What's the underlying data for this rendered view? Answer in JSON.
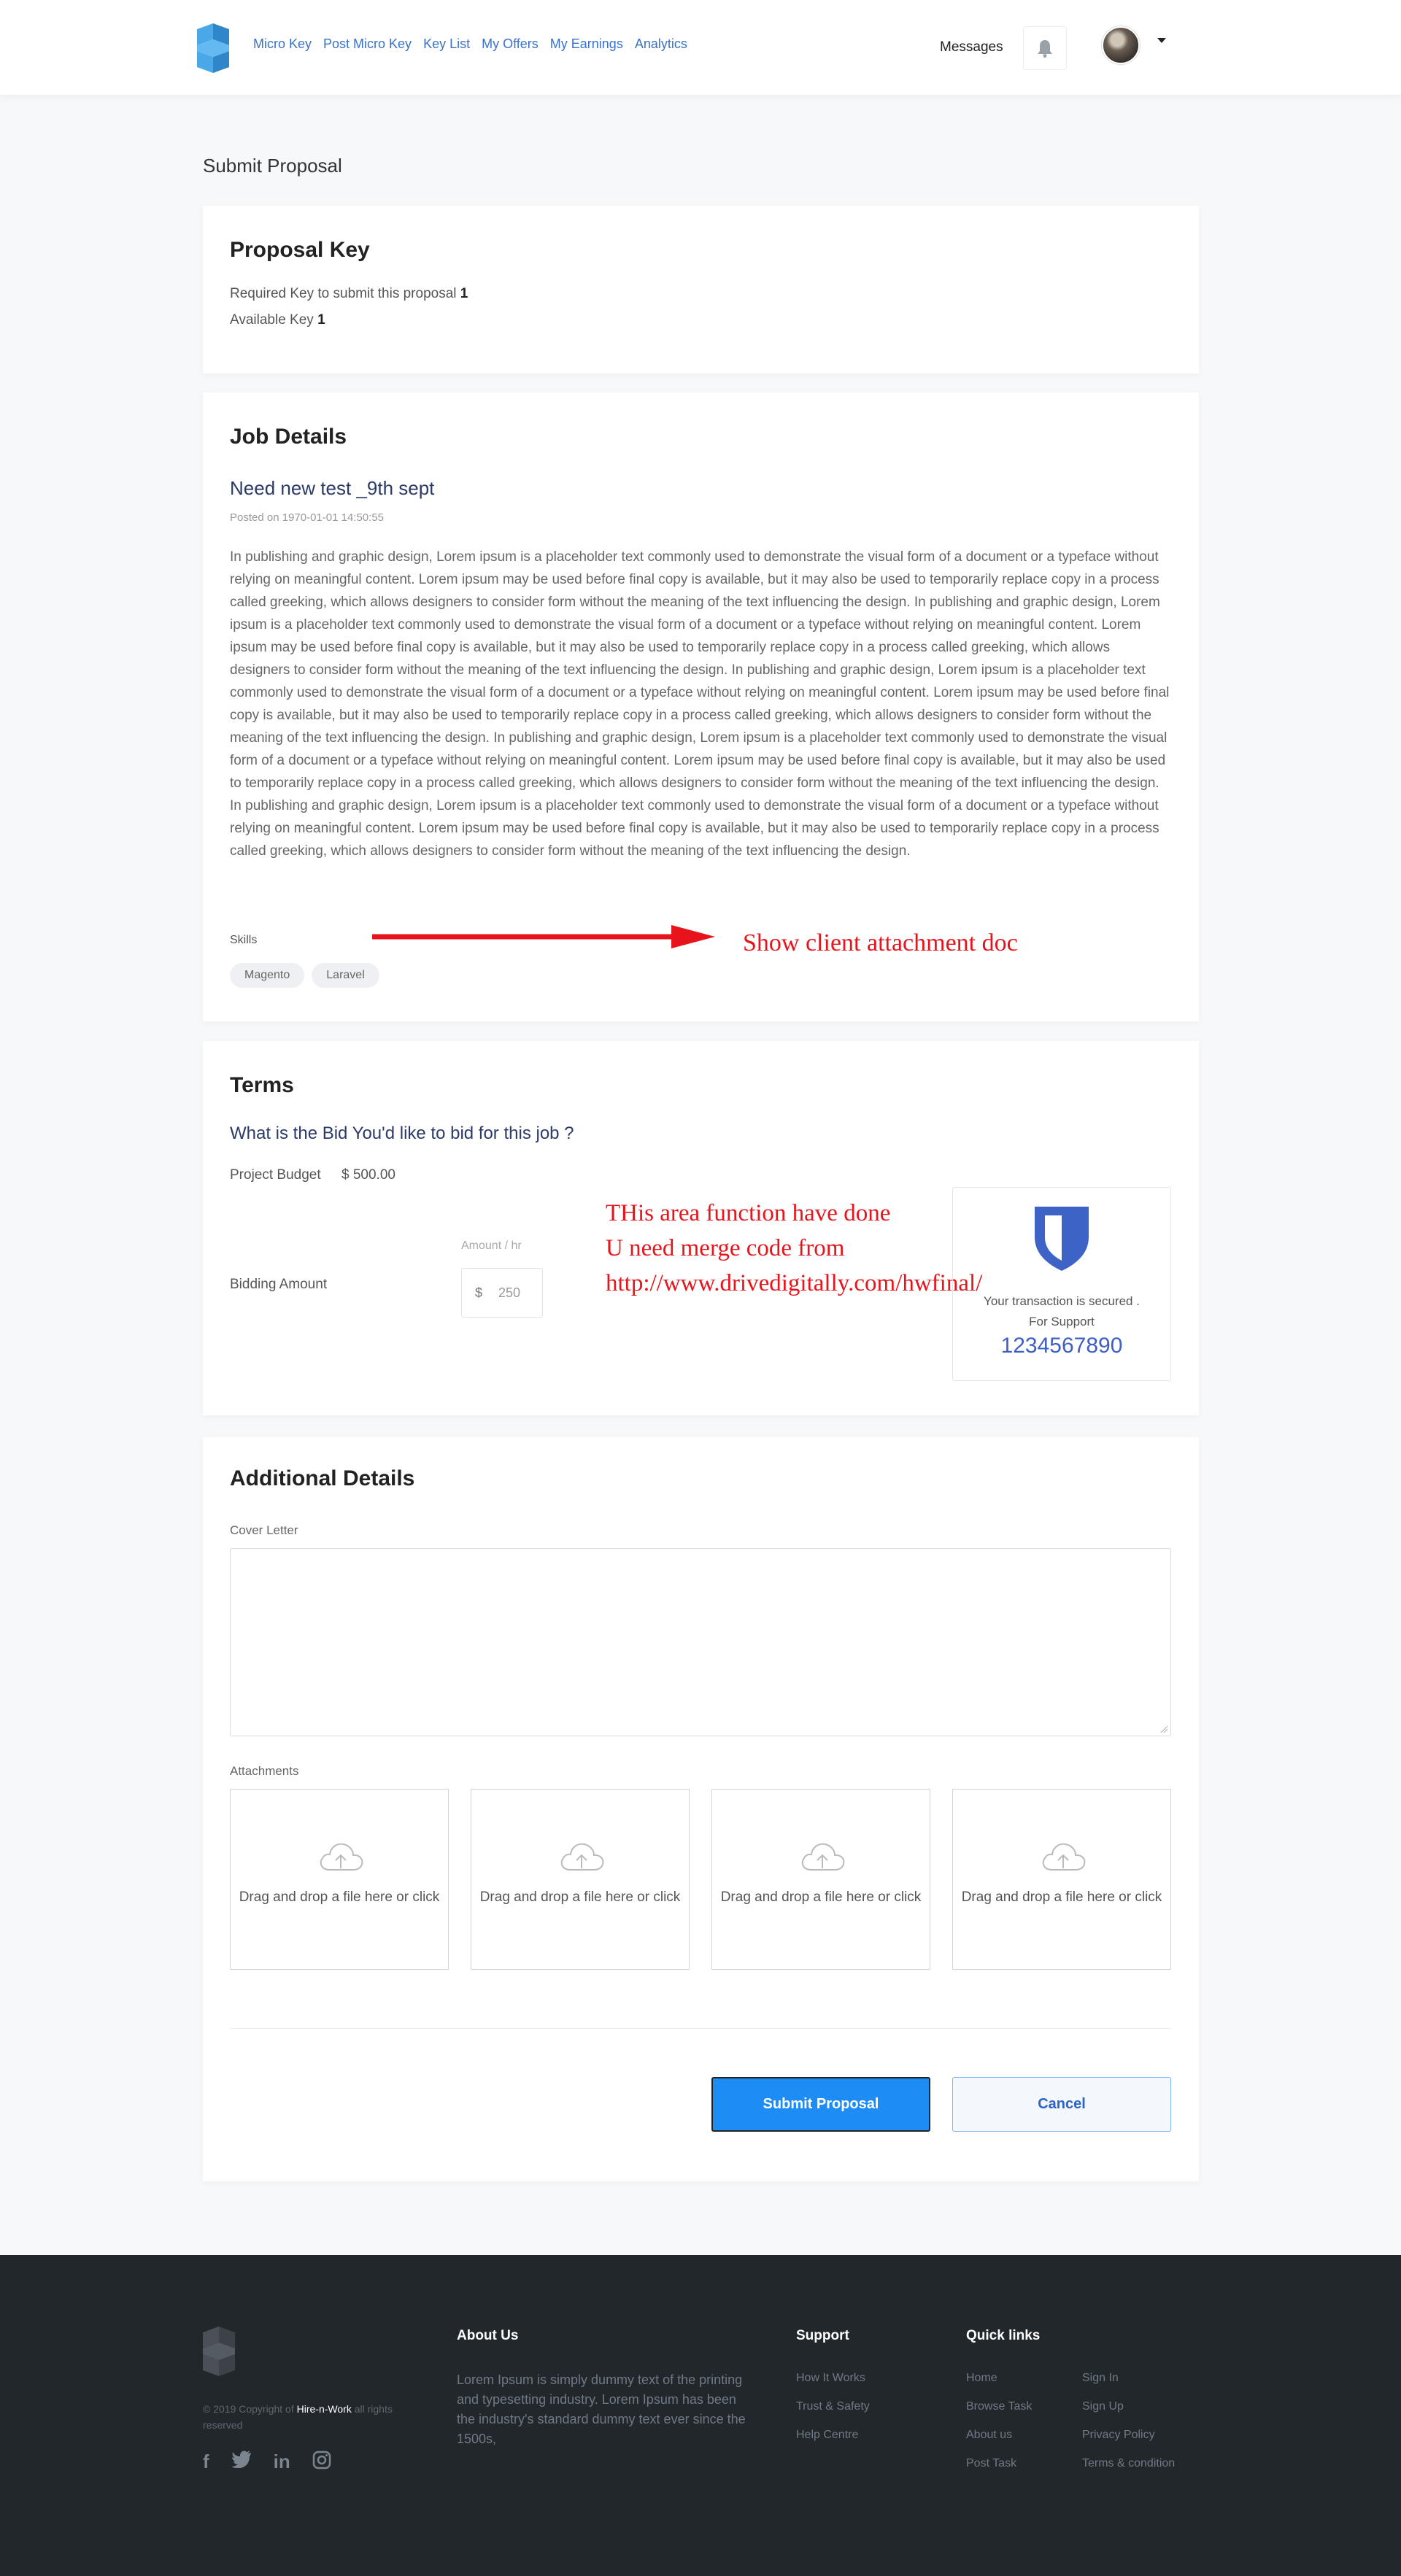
{
  "header": {
    "nav": [
      "Micro Key",
      "Post Micro Key",
      "Key List",
      "My Offers",
      "My Earnings",
      "Analytics"
    ],
    "messages": "Messages"
  },
  "page_title": "Submit Proposal",
  "proposal_key": {
    "title": "Proposal Key",
    "required_label": "Required Key to submit this proposal",
    "required_value": "1",
    "available_label": "Available Key",
    "available_value": "1"
  },
  "job": {
    "section_title": "Job Details",
    "title": "Need new test _9th sept",
    "posted": "Posted on 1970-01-01 14:50:55",
    "description": "In publishing and graphic design, Lorem ipsum is a placeholder text commonly used to demonstrate the visual form of a document or a typeface without relying on meaningful content. Lorem ipsum may be used before final copy is available, but it may also be used to temporarily replace copy in a process called greeking, which allows designers to consider form without the meaning of the text influencing the design. In publishing and graphic design, Lorem ipsum is a placeholder text commonly used to demonstrate the visual form of a document or a typeface without relying on meaningful content. Lorem ipsum may be used before final copy is available, but it may also be used to temporarily replace copy in a process called greeking, which allows designers to consider form without the meaning of the text influencing the design. In publishing and graphic design, Lorem ipsum is a placeholder text commonly used to demonstrate the visual form of a document or a typeface without relying on meaningful content. Lorem ipsum may be used before final copy is available, but it may also be used to temporarily replace copy in a process called greeking, which allows designers to consider form without the meaning of the text influencing the design. In publishing and graphic design, Lorem ipsum is a placeholder text commonly used to demonstrate the visual form of a document or a typeface without relying on meaningful content. Lorem ipsum may be used before final copy is available, but it may also be used to temporarily replace copy in a process called greeking, which allows designers to consider form without the meaning of the text influencing the design. In publishing and graphic design, Lorem ipsum is a placeholder text commonly used to demonstrate the visual form of a document or a typeface without relying on meaningful content. Lorem ipsum may be used before final copy is available, but it may also be used to temporarily replace copy in a process called greeking, which allows designers to consider form without the meaning of the text influencing the design.",
    "skills_label": "Skills",
    "skills": [
      "Magento",
      "Laravel"
    ],
    "annotation": "Show client attachment doc"
  },
  "terms": {
    "title": "Terms",
    "question": "What is the Bid You'd like to bid for this job ?",
    "budget_label": "Project Budget",
    "budget_value": "$ 500.00",
    "rate_label": "Amount / hr",
    "bidding_label": "Bidding Amount",
    "currency": "$",
    "bid_placeholder": "250",
    "annotation_lines": [
      "THis area function have done",
      "U need merge code from",
      "http://www.drivedigitally.com/hwfinal/"
    ],
    "secure_text": "Your transaction is secured .",
    "support_text": "For Support",
    "support_phone": "1234567890"
  },
  "additional": {
    "title": "Additional Details",
    "cover_label": "Cover Letter",
    "attachments_label": "Attachments",
    "dropzones": [
      "Drag and drop a file here or click",
      "Drag and drop a file here or click",
      "Drag and drop a file here or click",
      "Drag and drop a file here or click"
    ],
    "submit": "Submit Proposal",
    "cancel": "Cancel"
  },
  "footer": {
    "copy_prefix": "© 2019 Copyright of",
    "brand": "Hire-n-Work",
    "copy_suffix": "all rights reserved",
    "social_icons": [
      "facebook-icon",
      "twitter-icon",
      "linkedin-icon",
      "instagram-icon"
    ],
    "about_title": "About Us",
    "about_text": "Lorem Ipsum is simply dummy text of the printing and typesetting industry. Lorem Ipsum has been the industry's standard dummy text ever since the 1500s,",
    "support_title": "Support",
    "support_links": [
      "How It Works",
      "Trust & Safety",
      "Help Centre"
    ],
    "quick_title": "Quick links",
    "quick_col1": [
      "Home",
      "Browse Task",
      "About us",
      "Post Task"
    ],
    "quick_col2": [
      "Sign In",
      "Sign Up",
      "Privacy Policy",
      "Terms & condition"
    ]
  },
  "colors": {
    "accent": "#1e8cf5",
    "nav": "#3a72c9",
    "annotation": "#e8141b",
    "footer": "#22272b"
  }
}
